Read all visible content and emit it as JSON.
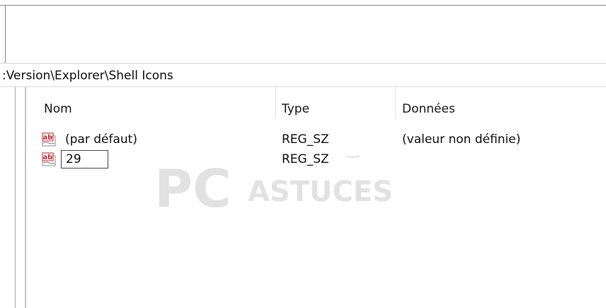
{
  "address": {
    "path": ":Version\\Explorer\\Shell Icons"
  },
  "columns": {
    "name": "Nom",
    "type": "Type",
    "data": "Données"
  },
  "rows": [
    {
      "icon": "reg-string-icon",
      "name": "(par défaut)",
      "type": "REG_SZ",
      "data": "(valeur non définie)"
    },
    {
      "icon": "reg-string-icon",
      "name": "29",
      "type": "REG_SZ",
      "data": ""
    }
  ],
  "watermark": {
    "text_large": "PC",
    "text_small": "ASTUCES"
  }
}
